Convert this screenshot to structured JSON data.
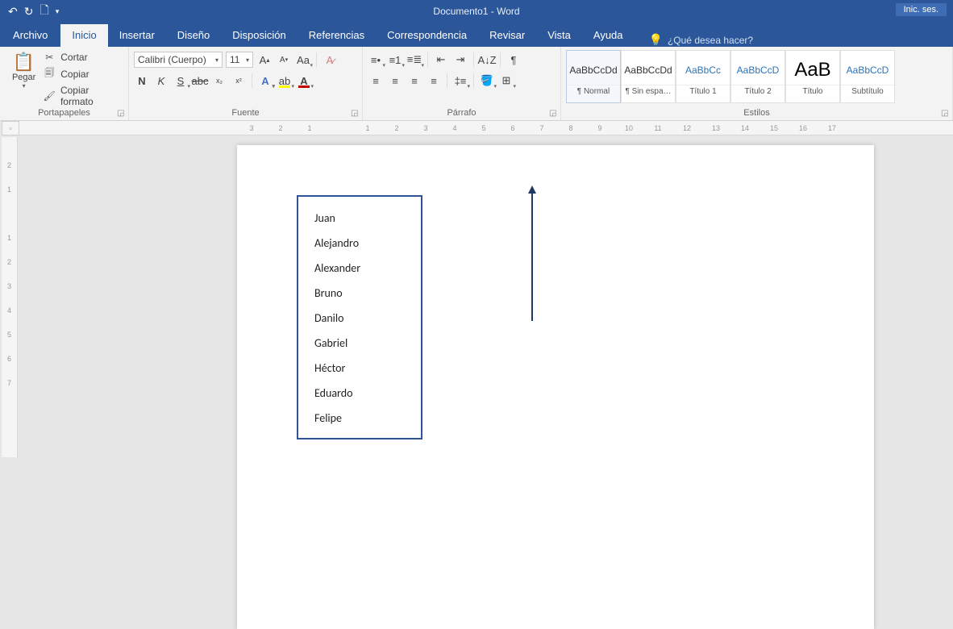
{
  "title": "Documento1 - Word",
  "signin": "Inic. ses.",
  "qat": {
    "undo": "↶",
    "redo": "↻",
    "new": "🗋",
    "more": "▾"
  },
  "tabs": {
    "file": "Archivo",
    "items": [
      "Inicio",
      "Insertar",
      "Diseño",
      "Disposición",
      "Referencias",
      "Correspondencia",
      "Revisar",
      "Vista",
      "Ayuda"
    ],
    "active": "Inicio",
    "tellme": "¿Qué desea hacer?"
  },
  "clipboard": {
    "paste": "Pegar",
    "cut": "Cortar",
    "copy": "Copiar",
    "format_painter": "Copiar formato",
    "group": "Portapapeles"
  },
  "font": {
    "name": "Calibri (Cuerpo)",
    "size": "11",
    "group": "Fuente"
  },
  "paragraph": {
    "group": "Párrafo"
  },
  "styles": {
    "group": "Estilos",
    "items": [
      {
        "preview": "AaBbCcDd",
        "name": "¶ Normal",
        "cls": ""
      },
      {
        "preview": "AaBbCcDd",
        "name": "¶ Sin espa…",
        "cls": ""
      },
      {
        "preview": "AaBbCc",
        "name": "Título 1",
        "cls": "heading"
      },
      {
        "preview": "AaBbCcD",
        "name": "Título 2",
        "cls": "heading"
      },
      {
        "preview": "AaB",
        "name": "Título",
        "cls": "big"
      },
      {
        "preview": "AaBbCcD",
        "name": "Subtítulo",
        "cls": "heading"
      }
    ]
  },
  "ruler_h": [
    "3",
    "2",
    "1",
    "",
    "1",
    "2",
    "3",
    "4",
    "5",
    "6",
    "7",
    "8",
    "9",
    "10",
    "11",
    "12",
    "13",
    "14",
    "15",
    "16",
    "17"
  ],
  "ruler_v": [
    "2",
    "1",
    "",
    "1",
    "2",
    "3",
    "4",
    "5",
    "6",
    "7"
  ],
  "document": {
    "names": [
      "Juan",
      "Alejandro",
      "Alexander",
      "Bruno",
      "Danilo",
      "Gabriel",
      "Héctor",
      "Eduardo",
      "Felipe"
    ]
  }
}
